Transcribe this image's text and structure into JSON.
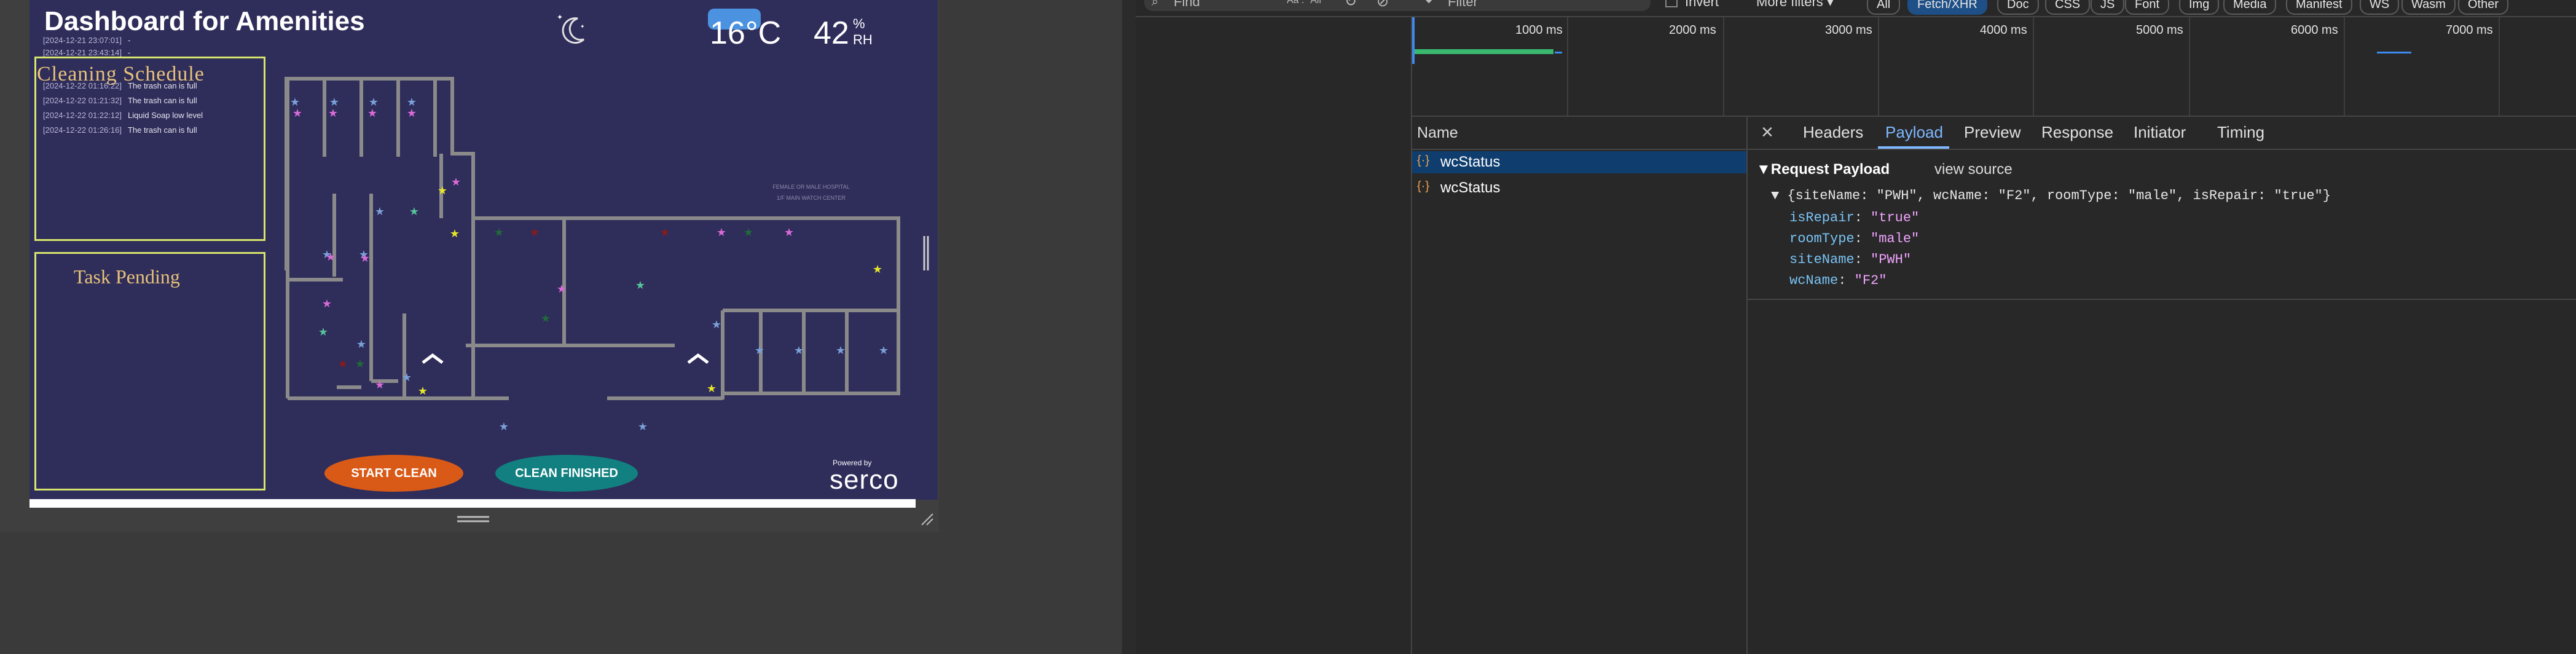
{
  "dashboard": {
    "title": "Dashboard for Amenities",
    "cleaning_schedule_title": "Cleaning Schedule",
    "task_pending_title": "Task Pending",
    "log_entries": [
      {
        "ts": "[2024-12-21 23:07:01]",
        "msg": "-"
      },
      {
        "ts": "[2024-12-21 23:43:14]",
        "msg": "-"
      },
      {
        "ts": "[2024-12-22 01:16:22]",
        "msg": "The trash can is full"
      },
      {
        "ts": "[2024-12-22 01:21:32]",
        "msg": "The trash can is full"
      },
      {
        "ts": "[2024-12-22 01:22:12]",
        "msg": "Liquid Soap low level"
      },
      {
        "ts": "[2024-12-22 01:26:16]",
        "msg": "The trash can is full"
      }
    ],
    "temperature": "16°C",
    "humidity": "42",
    "humidity_unit_top": "%",
    "humidity_unit_bottom": "RH",
    "start_button": "START CLEAN",
    "finish_button": "CLEAN FINISHED",
    "powered_by": "Powered by",
    "brand": "serco",
    "map_labels": [
      "FEMALE OR MALE HOSPITAL",
      "1/F MAIN WATCH CENTER"
    ],
    "colors": {
      "background": "#2f2d5a",
      "panel_border": "#d7e56a",
      "start_button": "#d95a17",
      "finish_button": "#128080",
      "wall": "#8a8a8a"
    }
  },
  "devtools": {
    "find_placeholder": "Find",
    "find_options": "Aa  .*  All",
    "filter_placeholder": "Filter",
    "invert_label": "Invert",
    "more_filters": "More filters ▾",
    "filter_chips": [
      "All",
      "Fetch/XHR",
      "Doc",
      "CSS",
      "JS",
      "Font",
      "Img",
      "Media",
      "Manifest",
      "WS",
      "Wasm",
      "Other"
    ],
    "timeline_ticks": [
      "1000 ms",
      "2000 ms",
      "3000 ms",
      "4000 ms",
      "5000 ms",
      "6000 ms",
      "7000 ms"
    ],
    "name_header": "Name",
    "requests": [
      "wcStatus",
      "wcStatus"
    ],
    "tabs": [
      "Headers",
      "Payload",
      "Preview",
      "Response",
      "Initiator",
      "Timing"
    ],
    "active_tab": "Payload",
    "payload_title": "▼Request Payload",
    "view_source": "view source",
    "payload_summary": "▼ {siteName: \"PWH\", wcName: \"F2\", roomType: \"male\", isRepair: \"true\"}",
    "payload_fields": [
      {
        "key": "isRepair",
        "value": "\"true\""
      },
      {
        "key": "roomType",
        "value": "\"male\""
      },
      {
        "key": "siteName",
        "value": "\"PWH\""
      },
      {
        "key": "wcName",
        "value": "\"F2\""
      }
    ]
  }
}
